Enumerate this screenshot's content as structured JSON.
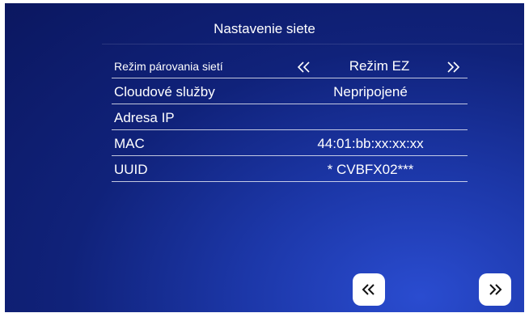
{
  "screen": {
    "title": "Nastavenie siete"
  },
  "rows": {
    "pairing": {
      "label": "Režim párovania sietí",
      "value": "Režim EZ"
    },
    "cloud": {
      "label": "Cloudové služby",
      "value": "Nepripojené"
    },
    "ip": {
      "label": "Adresa IP",
      "value": ""
    },
    "mac": {
      "label": "MAC",
      "value": "44:01:bb:xx:xx:xx"
    },
    "uuid": {
      "label": "UUID",
      "value": "* CVBFX02***"
    }
  },
  "icons": {
    "row_prev": "double-chevron-left-icon",
    "row_next": "double-chevron-right-icon",
    "page_prev": "double-chevron-left-icon",
    "page_next": "double-chevron-right-icon"
  },
  "colors": {
    "background_dark": "#0b1760",
    "background_light": "#2a4cd0",
    "text": "#ffffff",
    "button_bg": "#ffffff",
    "button_icon": "#111111"
  }
}
